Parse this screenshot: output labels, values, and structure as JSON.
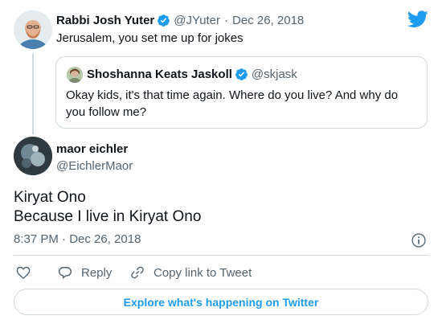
{
  "parent_tweet": {
    "name": "Rabbi Josh Yuter",
    "handle": "@JYuter",
    "separator": "·",
    "date": "Dec 26, 2018",
    "text": "Jerusalem, you set me up for jokes"
  },
  "quoted_tweet": {
    "name": "Shoshanna Keats Jaskoll",
    "handle": "@skjask",
    "text": "Okay kids, it's that time again. Where do you live? And why do you follow me?"
  },
  "main_tweet": {
    "name": "maor eichler",
    "handle": "@EichlerMaor",
    "text_line1": "Kiryat Ono",
    "text_line2": "Because I live in Kiryat Ono",
    "timestamp": "8:37 PM · Dec 26, 2018"
  },
  "actions": {
    "reply_label": "Reply",
    "copy_label": "Copy link to Tweet"
  },
  "explore_label": "Explore what's happening on Twitter",
  "icons": {
    "verified": "verified-badge-icon",
    "like": "heart-icon",
    "reply": "speech-bubble-icon",
    "copy": "link-icon",
    "info": "info-icon",
    "brand": "twitter-bird-icon"
  },
  "colors": {
    "accent": "#1d9bf0",
    "text": "#0f1419",
    "muted": "#536471",
    "border": "#cfd9de"
  }
}
